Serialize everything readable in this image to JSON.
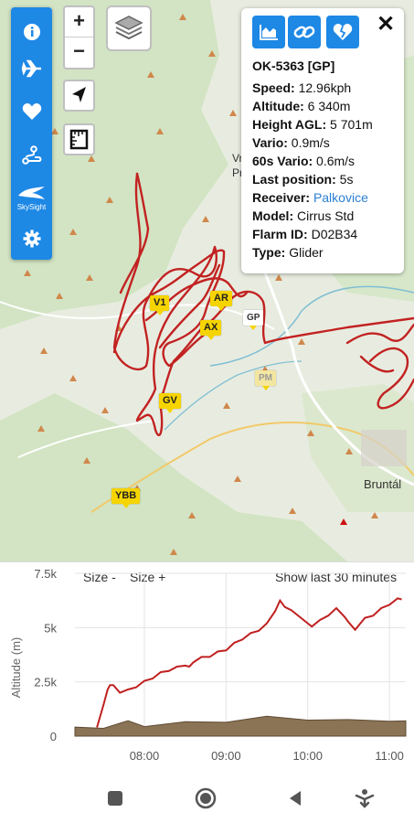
{
  "popup": {
    "title": "OK-5363 [GP]",
    "rows": [
      {
        "label": "Speed:",
        "value": "12.96kph"
      },
      {
        "label": "Altitude:",
        "value": "6 340m"
      },
      {
        "label": "Height AGL:",
        "value": "5 701m"
      },
      {
        "label": "Vario:",
        "value": "0.9m/s"
      },
      {
        "label": "60s Vario:",
        "value": "0.6m/s"
      },
      {
        "label": "Last position:",
        "value": "5s"
      },
      {
        "label": "Receiver:",
        "value": "Palkovice"
      },
      {
        "label": "Model:",
        "value": "Cirrus Std"
      },
      {
        "label": "Flarm ID:",
        "value": "D02B34"
      },
      {
        "label": "Type:",
        "value": "Glider"
      }
    ],
    "close": "✕"
  },
  "sidebar": {
    "items": [
      {
        "icon": "info-icon"
      },
      {
        "icon": "airplane-icon"
      },
      {
        "icon": "heart-icon"
      },
      {
        "icon": "route-icon"
      },
      {
        "icon": "skysight-icon",
        "label": "SkySight"
      },
      {
        "icon": "gear-icon"
      }
    ]
  },
  "map_controls": {
    "zoom_in": "+",
    "zoom_out": "−"
  },
  "waypoints": [
    {
      "name": "V1"
    },
    {
      "name": "AR"
    },
    {
      "name": "AX"
    },
    {
      "name": "GP"
    },
    {
      "name": "PM"
    },
    {
      "name": "GV"
    },
    {
      "name": "YBB"
    }
  ],
  "map_labels": {
    "town_bruntal": "Bruntál",
    "town_partial_1": "Vr",
    "town_partial_2": "Pr"
  },
  "chart_controls": {
    "size_minus": "Size -",
    "size_plus": "Size +",
    "show_last": "Show last 30 minutes"
  },
  "colors": {
    "accent": "#1e88e5",
    "track": "#c02020",
    "ground": "#8b7355",
    "waypoint": "#f6d400"
  },
  "chart_data": {
    "type": "area",
    "ylabel": "Altitude (m)",
    "xlabel": "",
    "ylim": [
      0,
      7500
    ],
    "yticks": [
      "0",
      "2.5k",
      "5k",
      "7.5k"
    ],
    "xticks": [
      "08:00",
      "09:00",
      "10:00",
      "11:00"
    ],
    "xrange_hours": [
      7.15,
      11.2
    ],
    "series": [
      {
        "name": "",
        "x": [
          7.42,
          7.5,
          7.55,
          7.58,
          7.62,
          7.7,
          7.8,
          7.9,
          8.0,
          8.1,
          8.2,
          8.3,
          8.4,
          8.5,
          8.55,
          8.6,
          8.7,
          8.8,
          8.9,
          9.0,
          9.1,
          9.2,
          9.3,
          9.4,
          9.5,
          9.6,
          9.66,
          9.72,
          9.8,
          9.9,
          10.0,
          10.05,
          10.15,
          10.25,
          10.35,
          10.45,
          10.5,
          10.58,
          10.7,
          10.8,
          10.9,
          11.0,
          11.1,
          11.15
        ],
        "y": [
          350,
          1500,
          2100,
          2400,
          2300,
          2050,
          2100,
          2300,
          2500,
          2700,
          2900,
          3050,
          3150,
          3300,
          3150,
          3450,
          3600,
          3700,
          3850,
          4000,
          4250,
          4500,
          4700,
          4900,
          5150,
          5800,
          6200,
          6000,
          5750,
          5550,
          5150,
          5100,
          5300,
          5600,
          5850,
          5550,
          5200,
          4950,
          5400,
          5600,
          5850,
          6100,
          6300,
          6350
        ]
      },
      {
        "name": "",
        "x": [
          7.15,
          7.5,
          7.8,
          8.0,
          8.5,
          9.0,
          9.5,
          10.0,
          10.5,
          11.0,
          11.2
        ],
        "y": [
          350,
          420,
          650,
          500,
          600,
          700,
          850,
          800,
          700,
          750,
          640
        ]
      }
    ]
  }
}
